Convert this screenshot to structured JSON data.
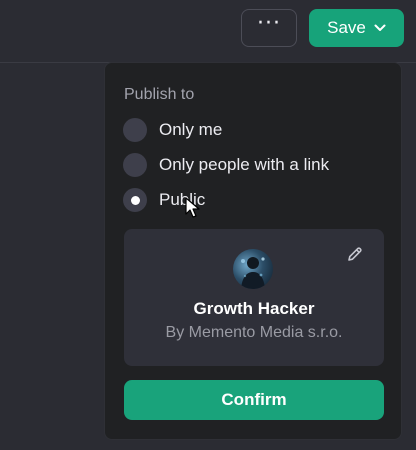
{
  "header": {
    "more_icon": "ellipsis-icon",
    "save_label": "Save",
    "save_chevron_icon": "chevron-down-icon",
    "accent_color": "#17a37a"
  },
  "publish_menu": {
    "title": "Publish to",
    "options": [
      {
        "label": "Only me",
        "selected": false
      },
      {
        "label": "Only people with a link",
        "selected": false
      },
      {
        "label": "Public",
        "selected": true
      }
    ]
  },
  "gpt_card": {
    "name": "Growth Hacker",
    "author": "By Memento Media s.r.o.",
    "edit_icon": "pencil-icon"
  },
  "confirm_label": "Confirm"
}
